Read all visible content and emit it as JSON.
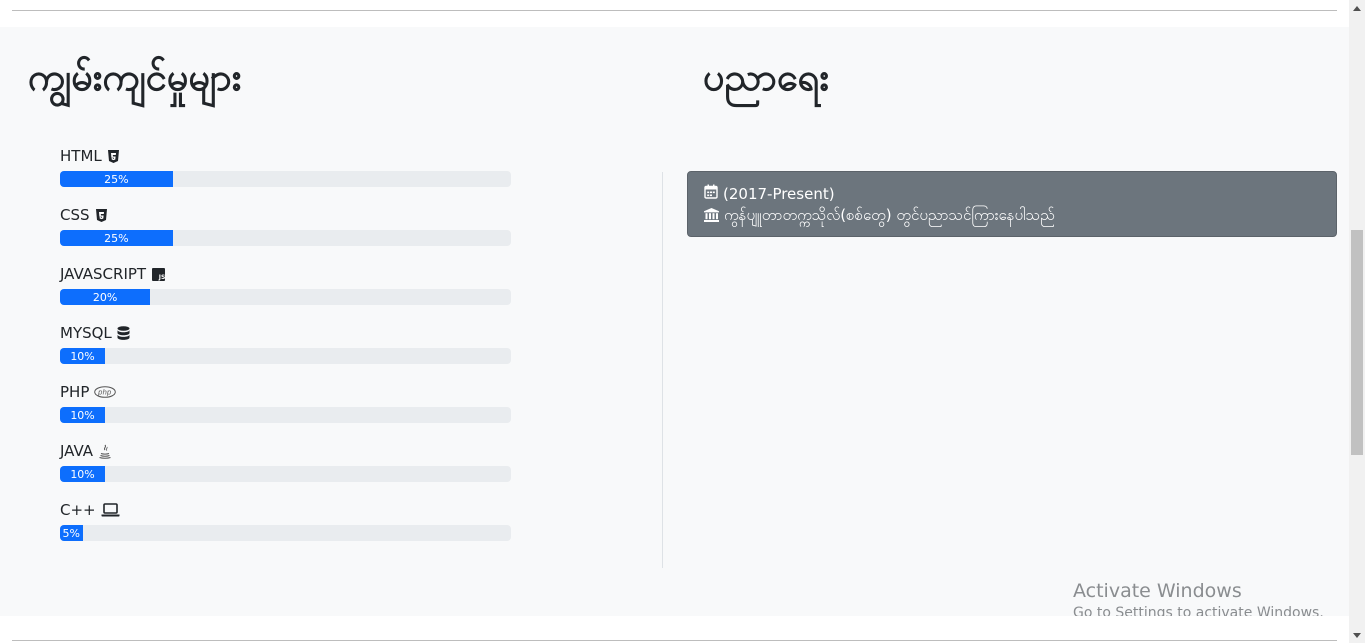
{
  "skills": {
    "title": "ကျွမ်းကျင်မှုများ",
    "items": [
      {
        "label": "HTML",
        "icon": "html5-icon",
        "percent": 25,
        "percent_label": "25%"
      },
      {
        "label": "CSS",
        "icon": "css3-icon",
        "percent": 25,
        "percent_label": "25%"
      },
      {
        "label": "JAVASCRIPT",
        "icon": "js-icon",
        "percent": 20,
        "percent_label": "20%"
      },
      {
        "label": "MYSQL",
        "icon": "database-icon",
        "percent": 10,
        "percent_label": "10%"
      },
      {
        "label": "PHP",
        "icon": "php-icon",
        "percent": 10,
        "percent_label": "10%"
      },
      {
        "label": "JAVA",
        "icon": "java-icon",
        "percent": 10,
        "percent_label": "10%"
      },
      {
        "label": "C++",
        "icon": "laptop-icon",
        "percent": 5,
        "percent_label": "5%"
      }
    ],
    "bar_color": "#0d6efd"
  },
  "education": {
    "title": "ပညာရေး",
    "card": {
      "period": "(2017-Present)",
      "institution": "ကွန်ပျူတာတက္ကသိုလ်(စစ်တွေ) တွင်ပညာသင်ကြားနေပါသည်"
    },
    "card_color": "#6c757d"
  },
  "watermark": {
    "title": "Activate Windows",
    "subtitle": "Go to Settings to activate Windows."
  }
}
